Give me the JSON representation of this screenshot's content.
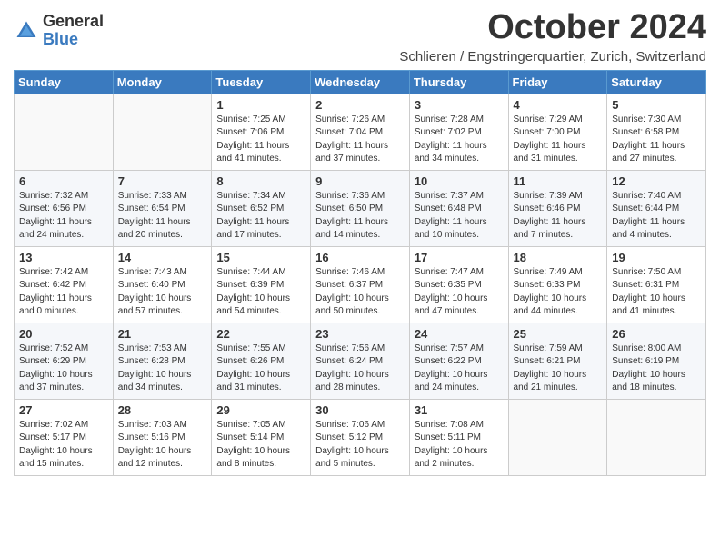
{
  "logo": {
    "general": "General",
    "blue": "Blue"
  },
  "title": "October 2024",
  "location": "Schlieren / Engstringerquartier, Zurich, Switzerland",
  "days_of_week": [
    "Sunday",
    "Monday",
    "Tuesday",
    "Wednesday",
    "Thursday",
    "Friday",
    "Saturday"
  ],
  "weeks": [
    [
      {
        "day": "",
        "sunrise": "",
        "sunset": "",
        "daylight": ""
      },
      {
        "day": "",
        "sunrise": "",
        "sunset": "",
        "daylight": ""
      },
      {
        "day": "1",
        "sunrise": "Sunrise: 7:25 AM",
        "sunset": "Sunset: 7:06 PM",
        "daylight": "Daylight: 11 hours and 41 minutes."
      },
      {
        "day": "2",
        "sunrise": "Sunrise: 7:26 AM",
        "sunset": "Sunset: 7:04 PM",
        "daylight": "Daylight: 11 hours and 37 minutes."
      },
      {
        "day": "3",
        "sunrise": "Sunrise: 7:28 AM",
        "sunset": "Sunset: 7:02 PM",
        "daylight": "Daylight: 11 hours and 34 minutes."
      },
      {
        "day": "4",
        "sunrise": "Sunrise: 7:29 AM",
        "sunset": "Sunset: 7:00 PM",
        "daylight": "Daylight: 11 hours and 31 minutes."
      },
      {
        "day": "5",
        "sunrise": "Sunrise: 7:30 AM",
        "sunset": "Sunset: 6:58 PM",
        "daylight": "Daylight: 11 hours and 27 minutes."
      }
    ],
    [
      {
        "day": "6",
        "sunrise": "Sunrise: 7:32 AM",
        "sunset": "Sunset: 6:56 PM",
        "daylight": "Daylight: 11 hours and 24 minutes."
      },
      {
        "day": "7",
        "sunrise": "Sunrise: 7:33 AM",
        "sunset": "Sunset: 6:54 PM",
        "daylight": "Daylight: 11 hours and 20 minutes."
      },
      {
        "day": "8",
        "sunrise": "Sunrise: 7:34 AM",
        "sunset": "Sunset: 6:52 PM",
        "daylight": "Daylight: 11 hours and 17 minutes."
      },
      {
        "day": "9",
        "sunrise": "Sunrise: 7:36 AM",
        "sunset": "Sunset: 6:50 PM",
        "daylight": "Daylight: 11 hours and 14 minutes."
      },
      {
        "day": "10",
        "sunrise": "Sunrise: 7:37 AM",
        "sunset": "Sunset: 6:48 PM",
        "daylight": "Daylight: 11 hours and 10 minutes."
      },
      {
        "day": "11",
        "sunrise": "Sunrise: 7:39 AM",
        "sunset": "Sunset: 6:46 PM",
        "daylight": "Daylight: 11 hours and 7 minutes."
      },
      {
        "day": "12",
        "sunrise": "Sunrise: 7:40 AM",
        "sunset": "Sunset: 6:44 PM",
        "daylight": "Daylight: 11 hours and 4 minutes."
      }
    ],
    [
      {
        "day": "13",
        "sunrise": "Sunrise: 7:42 AM",
        "sunset": "Sunset: 6:42 PM",
        "daylight": "Daylight: 11 hours and 0 minutes."
      },
      {
        "day": "14",
        "sunrise": "Sunrise: 7:43 AM",
        "sunset": "Sunset: 6:40 PM",
        "daylight": "Daylight: 10 hours and 57 minutes."
      },
      {
        "day": "15",
        "sunrise": "Sunrise: 7:44 AM",
        "sunset": "Sunset: 6:39 PM",
        "daylight": "Daylight: 10 hours and 54 minutes."
      },
      {
        "day": "16",
        "sunrise": "Sunrise: 7:46 AM",
        "sunset": "Sunset: 6:37 PM",
        "daylight": "Daylight: 10 hours and 50 minutes."
      },
      {
        "day": "17",
        "sunrise": "Sunrise: 7:47 AM",
        "sunset": "Sunset: 6:35 PM",
        "daylight": "Daylight: 10 hours and 47 minutes."
      },
      {
        "day": "18",
        "sunrise": "Sunrise: 7:49 AM",
        "sunset": "Sunset: 6:33 PM",
        "daylight": "Daylight: 10 hours and 44 minutes."
      },
      {
        "day": "19",
        "sunrise": "Sunrise: 7:50 AM",
        "sunset": "Sunset: 6:31 PM",
        "daylight": "Daylight: 10 hours and 41 minutes."
      }
    ],
    [
      {
        "day": "20",
        "sunrise": "Sunrise: 7:52 AM",
        "sunset": "Sunset: 6:29 PM",
        "daylight": "Daylight: 10 hours and 37 minutes."
      },
      {
        "day": "21",
        "sunrise": "Sunrise: 7:53 AM",
        "sunset": "Sunset: 6:28 PM",
        "daylight": "Daylight: 10 hours and 34 minutes."
      },
      {
        "day": "22",
        "sunrise": "Sunrise: 7:55 AM",
        "sunset": "Sunset: 6:26 PM",
        "daylight": "Daylight: 10 hours and 31 minutes."
      },
      {
        "day": "23",
        "sunrise": "Sunrise: 7:56 AM",
        "sunset": "Sunset: 6:24 PM",
        "daylight": "Daylight: 10 hours and 28 minutes."
      },
      {
        "day": "24",
        "sunrise": "Sunrise: 7:57 AM",
        "sunset": "Sunset: 6:22 PM",
        "daylight": "Daylight: 10 hours and 24 minutes."
      },
      {
        "day": "25",
        "sunrise": "Sunrise: 7:59 AM",
        "sunset": "Sunset: 6:21 PM",
        "daylight": "Daylight: 10 hours and 21 minutes."
      },
      {
        "day": "26",
        "sunrise": "Sunrise: 8:00 AM",
        "sunset": "Sunset: 6:19 PM",
        "daylight": "Daylight: 10 hours and 18 minutes."
      }
    ],
    [
      {
        "day": "27",
        "sunrise": "Sunrise: 7:02 AM",
        "sunset": "Sunset: 5:17 PM",
        "daylight": "Daylight: 10 hours and 15 minutes."
      },
      {
        "day": "28",
        "sunrise": "Sunrise: 7:03 AM",
        "sunset": "Sunset: 5:16 PM",
        "daylight": "Daylight: 10 hours and 12 minutes."
      },
      {
        "day": "29",
        "sunrise": "Sunrise: 7:05 AM",
        "sunset": "Sunset: 5:14 PM",
        "daylight": "Daylight: 10 hours and 8 minutes."
      },
      {
        "day": "30",
        "sunrise": "Sunrise: 7:06 AM",
        "sunset": "Sunset: 5:12 PM",
        "daylight": "Daylight: 10 hours and 5 minutes."
      },
      {
        "day": "31",
        "sunrise": "Sunrise: 7:08 AM",
        "sunset": "Sunset: 5:11 PM",
        "daylight": "Daylight: 10 hours and 2 minutes."
      },
      {
        "day": "",
        "sunrise": "",
        "sunset": "",
        "daylight": ""
      },
      {
        "day": "",
        "sunrise": "",
        "sunset": "",
        "daylight": ""
      }
    ]
  ]
}
